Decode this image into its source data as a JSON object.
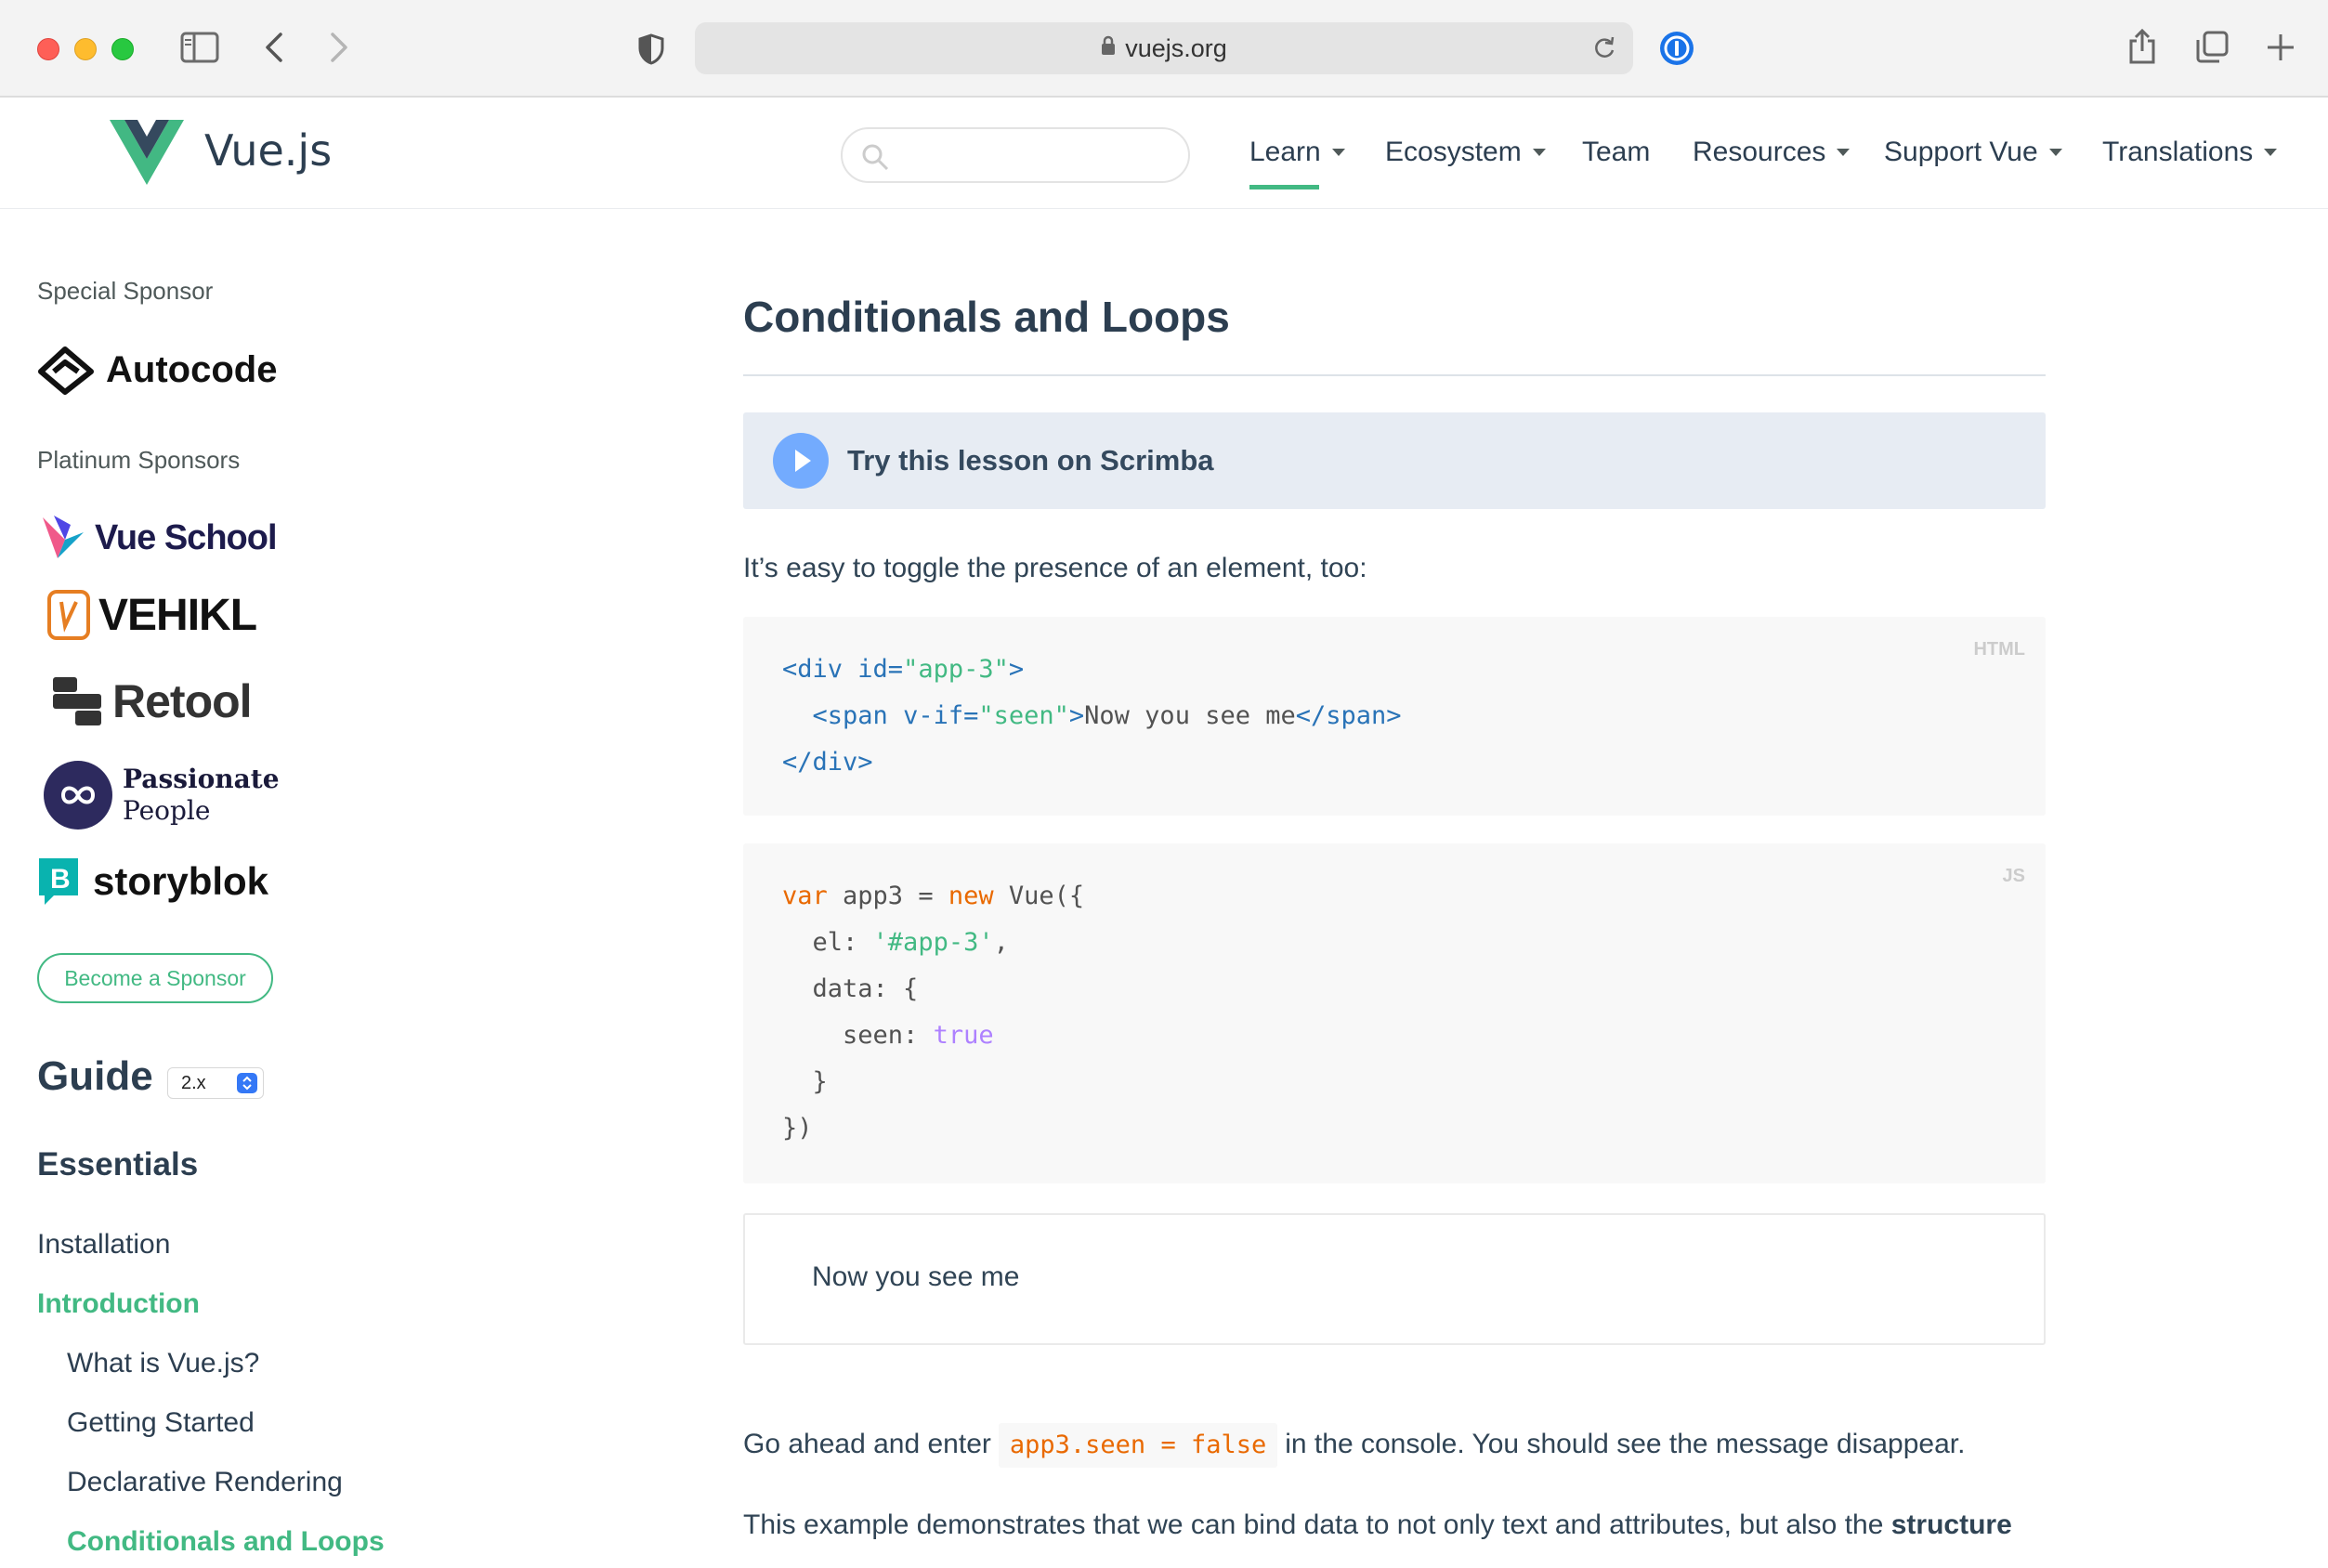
{
  "browser": {
    "url": "vuejs.org",
    "colors": {
      "chrome_bg": "#f3f3f3",
      "close": "#fe5f57",
      "minimize": "#febc2e",
      "zoom": "#28c840"
    },
    "icons": [
      "sidebar-icon",
      "back-icon",
      "forward-icon",
      "privacy-shield-icon",
      "lock-icon",
      "reload-icon",
      "password-manager-icon",
      "share-icon",
      "tabs-icon",
      "new-tab-icon"
    ]
  },
  "header": {
    "brand": "Vue.js",
    "search": {
      "value": "",
      "placeholder": ""
    },
    "nav": [
      {
        "label": "Learn",
        "dropdown": true,
        "active": true
      },
      {
        "label": "Ecosystem",
        "dropdown": true
      },
      {
        "label": "Team",
        "dropdown": false
      },
      {
        "label": "Resources",
        "dropdown": true
      },
      {
        "label": "Support Vue",
        "dropdown": true
      },
      {
        "label": "Translations",
        "dropdown": true
      }
    ]
  },
  "sidebar": {
    "special_sponsor_label": "Special Sponsor",
    "special_sponsor": "Autocode",
    "platinum_label": "Platinum Sponsors",
    "platinum": [
      "Vue School",
      "VEHIKL",
      "Retool",
      "Passionate",
      "People",
      "storyblok"
    ],
    "become_sponsor": "Become a Sponsor",
    "guide_title": "Guide",
    "version": "2.x",
    "section": "Essentials",
    "items": [
      {
        "label": "Installation",
        "level": "top"
      },
      {
        "label": "Introduction",
        "level": "top",
        "active": true
      },
      {
        "label": "What is Vue.js?",
        "level": "sub"
      },
      {
        "label": "Getting Started",
        "level": "sub"
      },
      {
        "label": "Declarative Rendering",
        "level": "sub"
      },
      {
        "label": "Conditionals and Loops",
        "level": "sub",
        "active": true
      }
    ]
  },
  "main": {
    "title": "Conditionals and Loops",
    "scrimba_label": "Try this lesson on Scrimba",
    "intro": "It’s easy to toggle the presence of an element, too:",
    "html_block": {
      "lang": "HTML",
      "l1_open": "<div ",
      "l1_attr": "id=",
      "l1_val": "\"app-3\"",
      "l1_close": ">",
      "l2_indent": "  ",
      "l2_open": "<span ",
      "l2_attr": "v-if=",
      "l2_val": "\"seen\"",
      "l2_close": ">",
      "l2_text": "Now you see me",
      "l2_end": "</span>",
      "l3": "</div>"
    },
    "js_block": {
      "lang": "JS",
      "l1_kw": "var",
      "l1_mid": " app3 = ",
      "l1_new": "new",
      "l1_end": " Vue({",
      "l2_key": "  el: ",
      "l2_val": "'#app-3'",
      "l2_end": ",",
      "l3": "  data: {",
      "l4_key": "    seen: ",
      "l4_val": "true",
      "l5": "  }",
      "l6": "})"
    },
    "demo_output": "Now you see me",
    "p2_before": "Go ahead and enter",
    "p2_code": "app3.seen = false",
    "p2_after": "in the console. You should see the message disappear.",
    "p3_start": "This example demonstrates that we can bind data to not only text and attributes, but also the ",
    "p3_bold": "structure",
    "accent_color": "#42b983"
  }
}
